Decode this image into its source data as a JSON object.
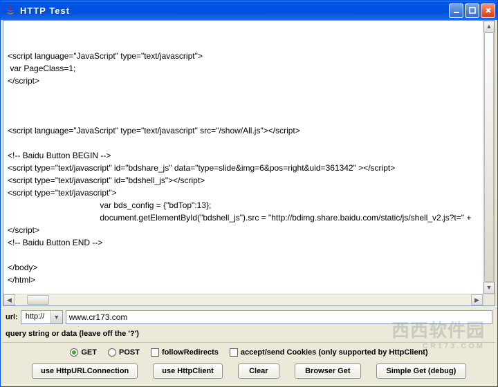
{
  "window": {
    "title": "HTTP Test",
    "icon": "java-icon"
  },
  "response_text": "\n\n<script language=\"JavaScript\" type=\"text/javascript\">\n var PageClass=1;\n</script>\n\n\n\n<script language=\"JavaScript\" type=\"text/javascript\" src=\"/show/All.js\"></script>\n\n<!-- Baidu Button BEGIN -->\n<script type=\"text/javascript\" id=\"bdshare_js\" data=\"type=slide&img=6&pos=right&uid=361342\" ></script>\n<script type=\"text/javascript\" id=\"bdshell_js\"></script>\n<script type=\"text/javascript\">\n                                        var bds_config = {\"bdTop\":13};\n                                        document.getElementById(\"bdshell_js\").src = \"http://bdimg.share.baidu.com/static/js/shell_v2.js?t=\" + \n</script>\n<!-- Baidu Button END -->\n\n</body>\n</html>",
  "url_row": {
    "label": "url:",
    "scheme": "http://",
    "host_value": "www.cr173.com"
  },
  "query_row": {
    "label": "query string or data (leave off the '?')"
  },
  "method": {
    "get_label": "GET",
    "post_label": "POST",
    "selected": "GET"
  },
  "options": {
    "follow_redirects_label": "followRedirects",
    "follow_redirects_checked": false,
    "cookies_label": "accept/send Cookies (only supported by HttpClient)",
    "cookies_checked": false
  },
  "buttons": {
    "use_urlconnection": "use HttpURLConnection",
    "use_httpclient": "use HttpClient",
    "clear": "Clear",
    "browser_get": "Browser Get",
    "simple_get": "Simple Get (debug)"
  },
  "watermark": {
    "main": "西西软件园",
    "sub": "CR173.COM"
  }
}
